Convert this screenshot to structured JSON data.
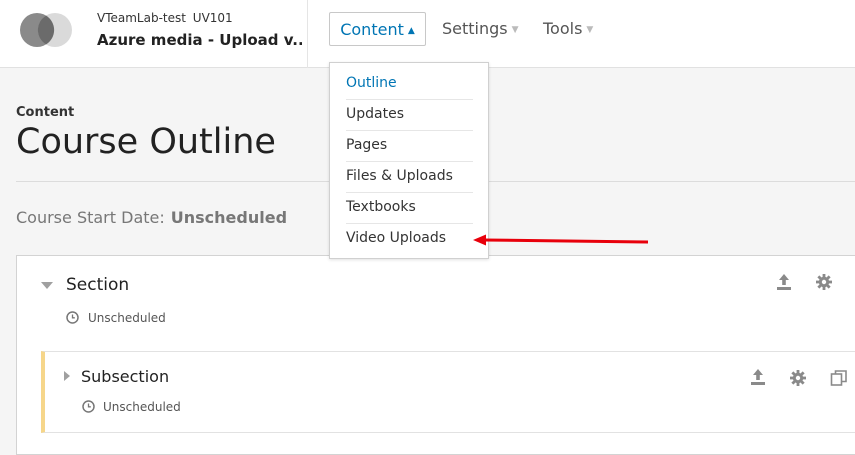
{
  "header": {
    "org": "VTeamLab-test",
    "course_number": "UV101",
    "course_title": "Azure media - Upload v..."
  },
  "nav": {
    "content": "Content",
    "settings": "Settings",
    "tools": "Tools"
  },
  "dropdown": {
    "items": [
      "Outline",
      "Updates",
      "Pages",
      "Files & Uploads",
      "Textbooks",
      "Video Uploads"
    ]
  },
  "page": {
    "subtitle": "Content",
    "title": "Course Outline",
    "start_date_label": "Course Start Date:",
    "start_date_value": "Unscheduled"
  },
  "outline": {
    "section": {
      "title": "Section",
      "status": "Unscheduled"
    },
    "subsection": {
      "title": "Subsection",
      "status": "Unscheduled"
    }
  },
  "colors": {
    "accent": "#0075b4",
    "annotation_arrow": "#e8000b",
    "subsection_border": "#f6d68a"
  },
  "icons": [
    "logo-icon",
    "caret-up-icon",
    "caret-down-icon",
    "collapse-icon",
    "expand-icon",
    "clock-icon",
    "publish-icon",
    "gear-icon",
    "duplicate-icon"
  ]
}
